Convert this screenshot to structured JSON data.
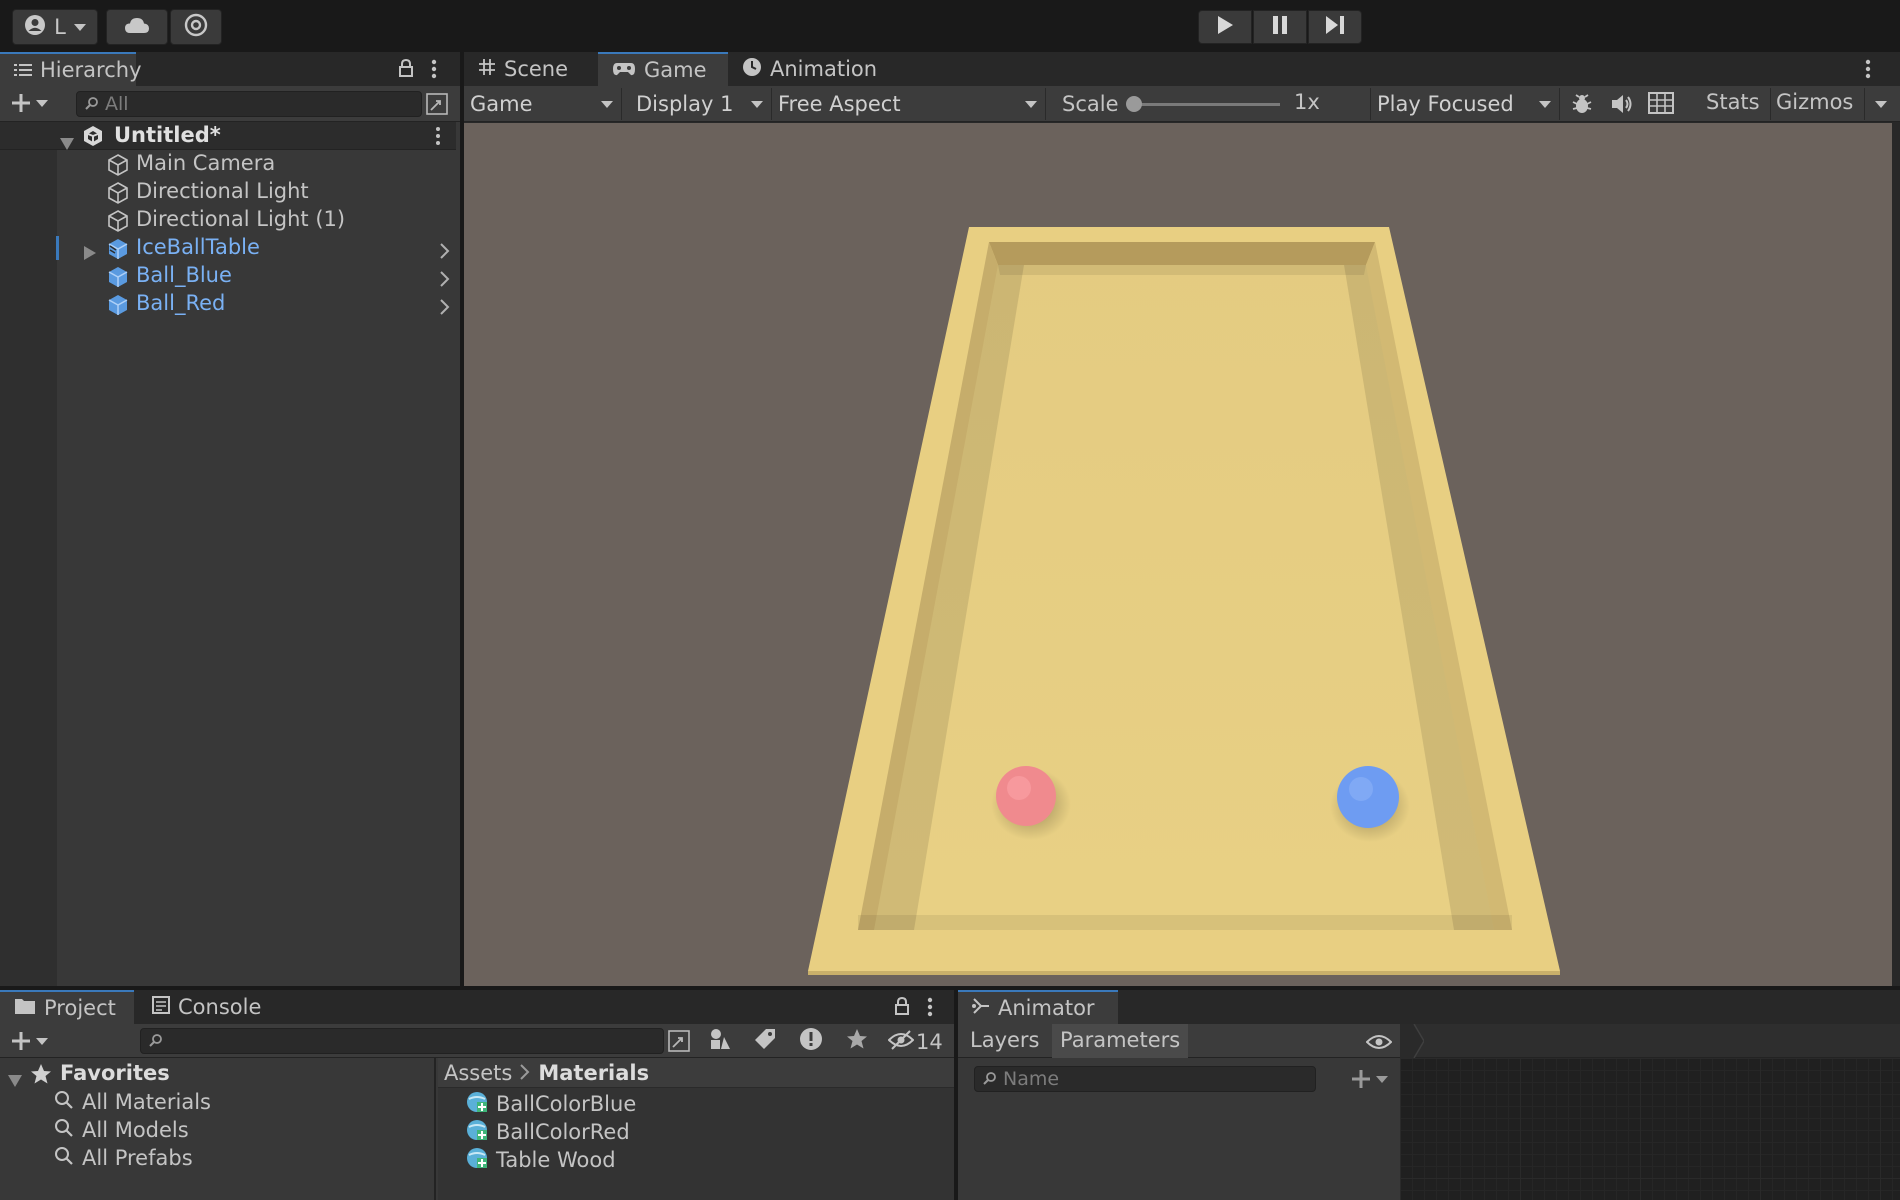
{
  "toolbar": {
    "account_label": "L",
    "play_icon": "play-icon",
    "pause_icon": "pause-icon",
    "step_icon": "step-icon"
  },
  "hierarchy": {
    "tab_label": "Hierarchy",
    "search_placeholder": "All",
    "scene_name": "Untitled*",
    "items": [
      {
        "label": "Main Camera",
        "type": "gameobject"
      },
      {
        "label": "Directional Light",
        "type": "gameobject"
      },
      {
        "label": "Directional Light (1)",
        "type": "gameobject"
      },
      {
        "label": "IceBallTable",
        "type": "prefab",
        "expandable": true
      },
      {
        "label": "Ball_Blue",
        "type": "prefab"
      },
      {
        "label": "Ball_Red",
        "type": "prefab"
      }
    ]
  },
  "center_tabs": {
    "scene": "Scene",
    "game": "Game",
    "animation": "Animation"
  },
  "game_bar": {
    "view_select": "Game",
    "display_select": "Display 1",
    "aspect_select": "Free Aspect",
    "scale_label": "Scale",
    "scale_value": "1x",
    "play_mode_select": "Play Focused",
    "stats_label": "Stats",
    "gizmos_label": "Gizmos"
  },
  "game_view": {
    "background_color": "#6b625c",
    "table_color": "#e8d084",
    "ball_red_color": "#f08a8e",
    "ball_blue_color": "#6e9cf2"
  },
  "project": {
    "project_tab": "Project",
    "console_tab": "Console",
    "hidden_count": "14",
    "favorites_label": "Favorites",
    "favorites": [
      "All Materials",
      "All Models",
      "All Prefabs"
    ],
    "breadcrumb_root": "Assets",
    "breadcrumb_current": "Materials",
    "assets": [
      "BallColorBlue",
      "BallColorRed",
      "Table Wood"
    ]
  },
  "animator": {
    "tab_label": "Animator",
    "layers_tab": "Layers",
    "parameters_tab": "Parameters",
    "search_placeholder": "Name"
  }
}
